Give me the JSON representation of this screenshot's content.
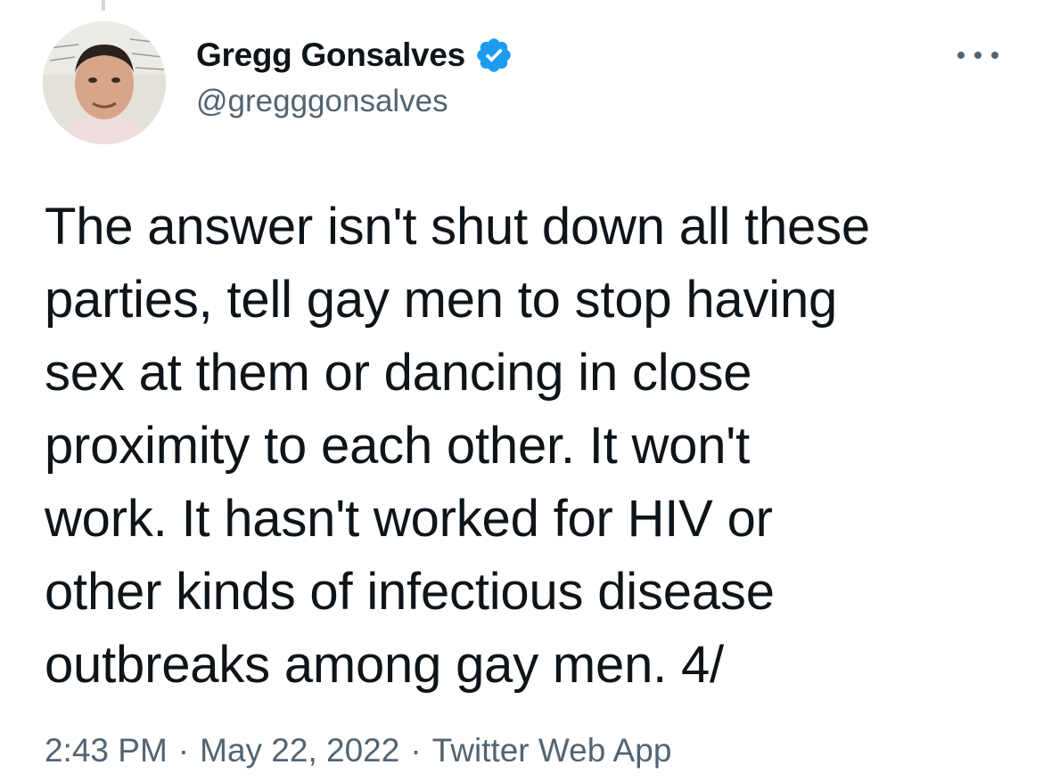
{
  "tweet": {
    "author": {
      "display_name": "Gregg Gonsalves",
      "handle": "@gregggonsalves",
      "verified": true,
      "avatar_icon": "profile-photo",
      "verified_icon": "verified-badge-icon"
    },
    "more_icon": "more-options-icon",
    "text_lines": [
      "The answer isn't shut down all these",
      "parties, tell gay men to stop having",
      "sex at them or dancing in close",
      "proximity to each other. It won't",
      "work. It hasn't worked for HIV or",
      "other kinds of infectious disease",
      "outbreaks among gay men. 4/"
    ],
    "meta": {
      "time": "2:43 PM",
      "separator": "·",
      "date": "May 22, 2022",
      "source": "Twitter Web App"
    }
  },
  "colors": {
    "text_primary": "#0f1419",
    "text_secondary": "#536471",
    "verified_blue": "#1d9bf0",
    "thread_line": "#cfd9de"
  }
}
